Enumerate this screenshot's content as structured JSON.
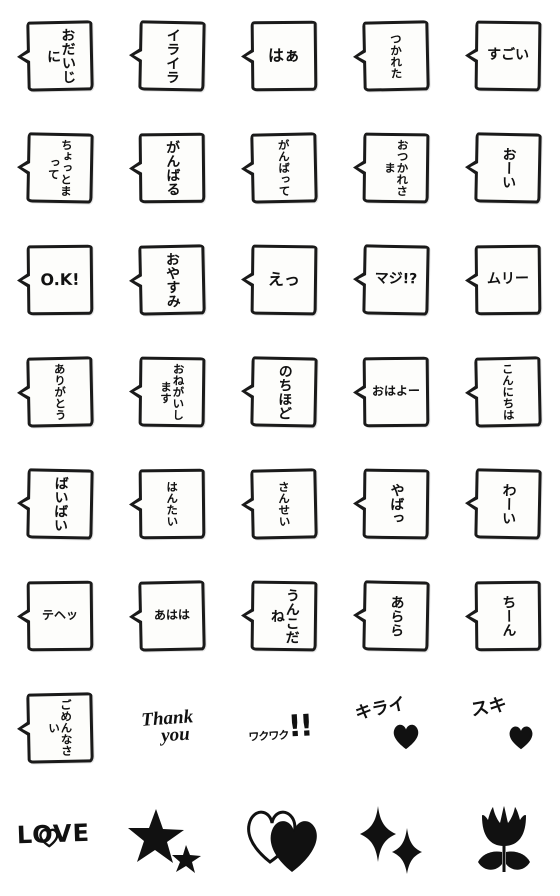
{
  "sheet": {
    "title": "Emoji sticker sheet",
    "columns": 5,
    "rows": 8,
    "background_color": "#ffffff",
    "ink_color": "#111111",
    "balloon_fill": "#fdfdfb"
  },
  "stickers": [
    {
      "id": "odaijini",
      "type": "balloon",
      "text": "おだいじに",
      "orientation": "vertical",
      "columns": [
        "おだい",
        "じに"
      ]
    },
    {
      "id": "iraira",
      "type": "balloon",
      "text": "イライラ",
      "orientation": "vertical",
      "columns": [
        "イラ",
        "イラ"
      ]
    },
    {
      "id": "haa",
      "type": "balloon",
      "text": "はぁ",
      "orientation": "horizontal",
      "columns": [
        "は",
        "ぁ"
      ]
    },
    {
      "id": "tsukareta",
      "type": "balloon",
      "text": "つかれた",
      "orientation": "vertical",
      "columns": [
        "つかれた"
      ]
    },
    {
      "id": "sugoi",
      "type": "balloon",
      "text": "すごい",
      "orientation": "horizontal",
      "columns": [
        "すごい"
      ]
    },
    {
      "id": "chotto-matte",
      "type": "balloon",
      "text": "ちょっとまって",
      "orientation": "vertical",
      "columns": [
        "ちょっと",
        "まって"
      ]
    },
    {
      "id": "ganbaru",
      "type": "balloon",
      "text": "がんばる",
      "orientation": "vertical",
      "columns": [
        "がん",
        "ばる"
      ]
    },
    {
      "id": "ganbatte",
      "type": "balloon",
      "text": "がんばって",
      "orientation": "vertical",
      "columns": [
        "がん",
        "ばって"
      ]
    },
    {
      "id": "otsukaresama",
      "type": "balloon",
      "text": "おつかれさま",
      "orientation": "vertical",
      "columns": [
        "おつかれ",
        "さま"
      ]
    },
    {
      "id": "ooi",
      "type": "balloon",
      "text": "おーい",
      "orientation": "vertical",
      "columns": [
        "おーい"
      ]
    },
    {
      "id": "ok",
      "type": "balloon",
      "text": "O.K!",
      "orientation": "horizontal",
      "columns": [
        "O.K!"
      ]
    },
    {
      "id": "oyasumi",
      "type": "balloon",
      "text": "おやすみ",
      "orientation": "vertical",
      "columns": [
        "おや",
        "すみ"
      ]
    },
    {
      "id": "e",
      "type": "balloon",
      "text": "えっ",
      "orientation": "horizontal",
      "columns": [
        "え",
        "っ"
      ]
    },
    {
      "id": "maji",
      "type": "balloon",
      "text": "マジ!?",
      "orientation": "horizontal",
      "columns": [
        "マジ",
        "!?"
      ]
    },
    {
      "id": "muri",
      "type": "balloon",
      "text": "ムリー",
      "orientation": "horizontal",
      "columns": [
        "ムリー"
      ]
    },
    {
      "id": "arigatou",
      "type": "balloon",
      "text": "ありがとう",
      "orientation": "vertical",
      "columns": [
        "あり",
        "がとう"
      ]
    },
    {
      "id": "onegaishimasu",
      "type": "balloon",
      "text": "おねがいします",
      "orientation": "vertical",
      "columns": [
        "おねがい",
        "します"
      ]
    },
    {
      "id": "nochihodo",
      "type": "balloon",
      "text": "のちほど",
      "orientation": "vertical",
      "columns": [
        "のち",
        "ほど"
      ]
    },
    {
      "id": "ohayo",
      "type": "balloon",
      "text": "おはよー",
      "orientation": "horizontal",
      "columns": [
        "おはよー"
      ]
    },
    {
      "id": "konnichiwa",
      "type": "balloon",
      "text": "こんにちは",
      "orientation": "vertical",
      "columns": [
        "こんに",
        "ちは"
      ]
    },
    {
      "id": "baibai",
      "type": "balloon",
      "text": "ばいばい",
      "orientation": "vertical",
      "columns": [
        "ばい",
        "ばい"
      ]
    },
    {
      "id": "hantai",
      "type": "balloon",
      "text": "はんたい",
      "orientation": "vertical",
      "columns": [
        "はんたい"
      ]
    },
    {
      "id": "sansei",
      "type": "balloon",
      "text": "さんせい",
      "orientation": "vertical",
      "columns": [
        "さんせい"
      ]
    },
    {
      "id": "yabaa",
      "type": "balloon",
      "text": "やばっ",
      "orientation": "vertical",
      "columns": [
        "やばっ"
      ]
    },
    {
      "id": "wai",
      "type": "balloon",
      "text": "わーい",
      "orientation": "vertical",
      "columns": [
        "わーい"
      ]
    },
    {
      "id": "tehe",
      "type": "balloon",
      "text": "テヘッ",
      "orientation": "horizontal",
      "columns": [
        "テヘッ"
      ]
    },
    {
      "id": "ahaha",
      "type": "balloon",
      "text": "あはは",
      "orientation": "horizontal",
      "columns": [
        "あはは"
      ]
    },
    {
      "id": "unko-dane",
      "type": "balloon",
      "text": "うんこだね",
      "orientation": "vertical",
      "columns": [
        "うんこ",
        "だね"
      ]
    },
    {
      "id": "arara",
      "type": "balloon",
      "text": "あらら",
      "orientation": "vertical",
      "columns": [
        "あらら"
      ]
    },
    {
      "id": "chiin",
      "type": "balloon",
      "text": "ちーん",
      "orientation": "vertical",
      "columns": [
        "ちーん"
      ]
    },
    {
      "id": "gomennasai",
      "type": "balloon",
      "text": "ごめんなさい",
      "orientation": "vertical",
      "columns": [
        "ごめん",
        "なさい"
      ]
    },
    {
      "id": "thank-you",
      "type": "ink-text",
      "text": "Thank you",
      "line1": "Thank",
      "line2": "you"
    },
    {
      "id": "wakuwaku",
      "type": "ink-text",
      "text": "ワクワク!!",
      "kana": "ワクワク",
      "marks": "!!"
    },
    {
      "id": "kirai-heart",
      "type": "ink-text",
      "text": "キライ",
      "icon": "heart-filled-icon"
    },
    {
      "id": "suki-heart",
      "type": "ink-text",
      "text": "スキ",
      "icon": "heart-filled-icon"
    },
    {
      "id": "love",
      "type": "ink-text",
      "text": "LOVE",
      "icon": "heart-outline-icon"
    },
    {
      "id": "stars",
      "type": "icon",
      "text": "",
      "icon": "two-stars-icon"
    },
    {
      "id": "hearts",
      "type": "icon",
      "text": "",
      "icon": "two-hearts-icon"
    },
    {
      "id": "sparkles",
      "type": "icon",
      "text": "",
      "icon": "sparkles-icon"
    },
    {
      "id": "tulip",
      "type": "icon",
      "text": "",
      "icon": "tulip-icon"
    }
  ]
}
